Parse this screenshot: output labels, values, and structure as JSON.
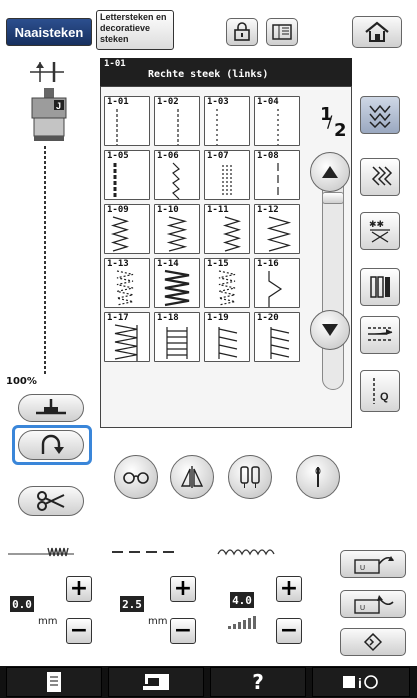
{
  "header": {
    "tab_utility": "Naaisteken",
    "tab_decorative_line1": "Lettersteken en",
    "tab_decorative_line2": "decoratieve",
    "tab_decorative_line3": "steken"
  },
  "stitch_info": {
    "code": "1-01",
    "name": "Rechte steek (links)"
  },
  "page_indicator": {
    "current": "1",
    "total": "2"
  },
  "stitches": [
    {
      "code": "1-01",
      "kind": "straight-left"
    },
    {
      "code": "1-02",
      "kind": "straight-mid"
    },
    {
      "code": "1-03",
      "kind": "triple-left"
    },
    {
      "code": "1-04",
      "kind": "triple-mid"
    },
    {
      "code": "1-05",
      "kind": "stretch"
    },
    {
      "code": "1-06",
      "kind": "lightning"
    },
    {
      "code": "1-07",
      "kind": "stem"
    },
    {
      "code": "1-08",
      "kind": "basting"
    },
    {
      "code": "1-09",
      "kind": "zigzag-left"
    },
    {
      "code": "1-10",
      "kind": "zigzag-mid"
    },
    {
      "code": "1-11",
      "kind": "zigzag-right"
    },
    {
      "code": "1-12",
      "kind": "zigzag-wide"
    },
    {
      "code": "1-13",
      "kind": "dotted-zigzag"
    },
    {
      "code": "1-14",
      "kind": "triple-zigzag"
    },
    {
      "code": "1-15",
      "kind": "dotted-zigzag-2"
    },
    {
      "code": "1-16",
      "kind": "blind-v"
    },
    {
      "code": "1-17",
      "kind": "overcast-zig"
    },
    {
      "code": "1-18",
      "kind": "overcast-ladder"
    },
    {
      "code": "1-19",
      "kind": "overcast-comb"
    },
    {
      "code": "1-20",
      "kind": "overcast-comb-2"
    }
  ],
  "left_panel": {
    "zoom": "100%"
  },
  "settings": {
    "stitch_width": {
      "value": "0.0",
      "unit": "mm"
    },
    "stitch_length": {
      "value": "2.5",
      "unit": "mm"
    },
    "thread_tension": {
      "value": "4.0"
    }
  },
  "bottom_bar": {
    "help_label": "?"
  },
  "colors": {
    "tab_active": "#1f3c73",
    "highlight_border": "#3a86d9",
    "value_box": "#222222"
  }
}
